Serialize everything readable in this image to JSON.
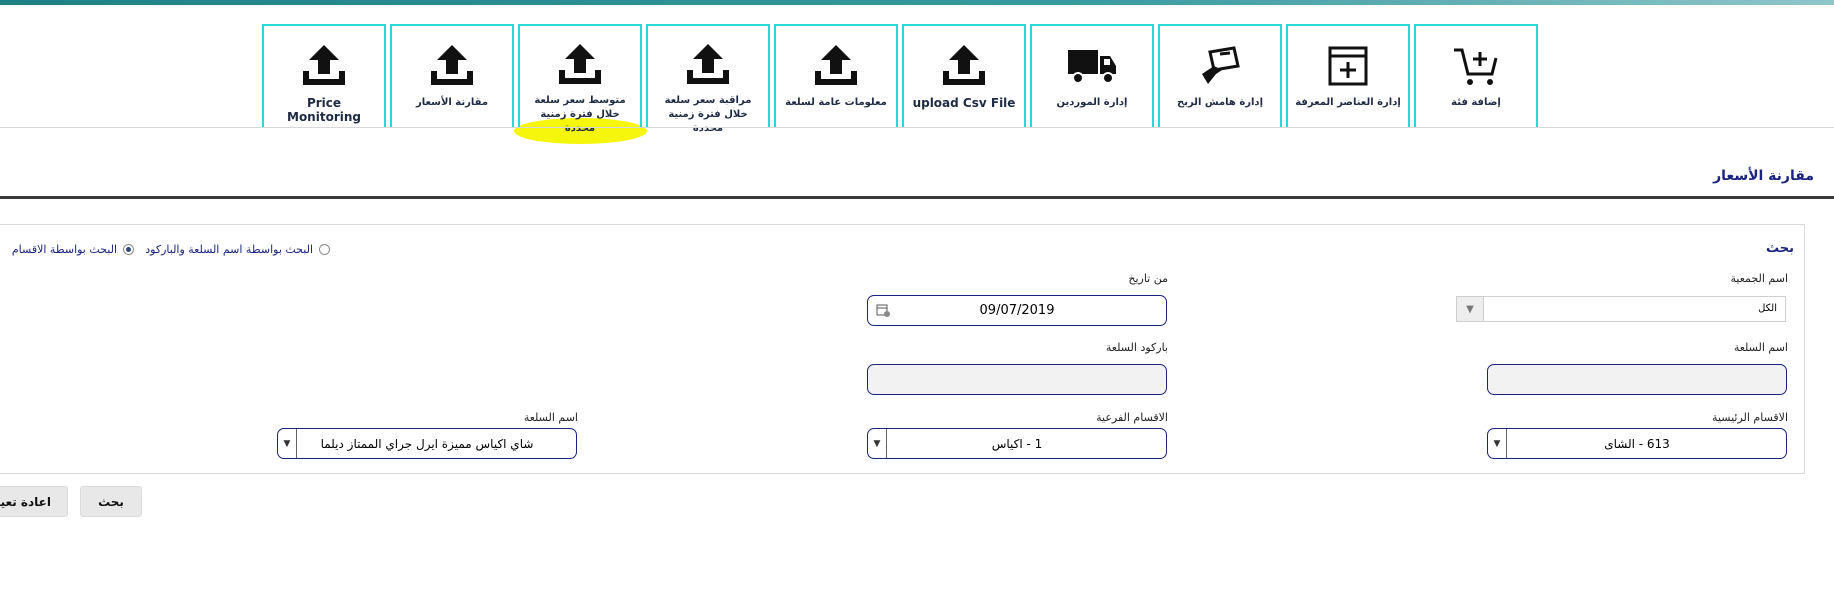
{
  "toolbar": {
    "tiles": [
      {
        "label": "Price Monitoring",
        "icon": "upload-icon"
      },
      {
        "label": "مقارنة الأسعار",
        "icon": "upload-icon"
      },
      {
        "label": "متوسط سعر سلعة خلال فترة زمنية محددة",
        "icon": "upload-icon"
      },
      {
        "label": "مراقبة سعر سلعة خلال فترة زمنية محددة",
        "icon": "upload-icon"
      },
      {
        "label": "معلومات عامة لسلعة",
        "icon": "upload-icon"
      },
      {
        "label": "upload Csv File",
        "icon": "upload-icon"
      },
      {
        "label": "إدارة الموردين",
        "icon": "truck-icon"
      },
      {
        "label": "إدارة هامش الربح",
        "icon": "money-hand-icon"
      },
      {
        "label": "إدارة العناصر المعرفة",
        "icon": "window-plus-icon"
      },
      {
        "label": "إضافة فئة",
        "icon": "cart-plus-icon"
      }
    ]
  },
  "page": {
    "title": "مقارنة الأسعار"
  },
  "search": {
    "title": "بحث",
    "radio_by_name": "البحث بواسطة اسم السلعة والباركود",
    "radio_by_sections": "البحث بواسطة الاقسام",
    "society_label": "اسم الجمعية",
    "society_value": "الكل",
    "from_date_label": "من تاريخ",
    "from_date_value": "09/07/2019",
    "item_name_label": "اسم السلعة",
    "barcode_label": "باركود السلعة",
    "main_sections_label": "الاقسام الرئيسية",
    "main_sections_value": "613 - الشاى",
    "sub_sections_label": "الاقسام الفرعية",
    "sub_sections_value": "1 - اكياس",
    "item_name2_label": "اسم السلعة",
    "item_name2_value": "شاي اكياس مميزة ايرل جراي الممتاز ديلما"
  },
  "buttons": {
    "search": "بحث",
    "reset": "اعادة تعيين"
  },
  "colors": {
    "accent": "#1a237e",
    "tile_border": "#2ad8d8",
    "highlight": "#f5f500"
  }
}
